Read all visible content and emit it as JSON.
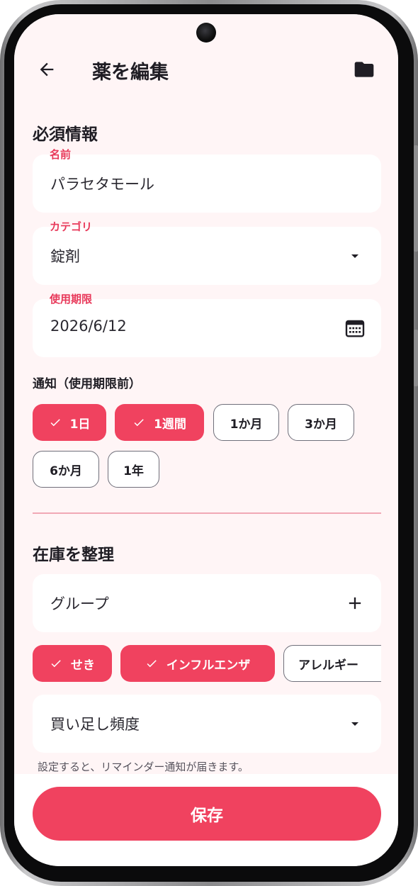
{
  "appbar": {
    "title": "薬を編集",
    "back_icon": "arrow-left-icon",
    "folder_icon": "folder-icon"
  },
  "required": {
    "section_title": "必須情報",
    "name": {
      "label": "名前",
      "value": "パラセタモール"
    },
    "category": {
      "label": "カテゴリ",
      "value": "錠剤",
      "icon": "dropdown-arrow-icon"
    },
    "expiry": {
      "label": "使用期限",
      "value": "2026/6/12",
      "icon": "calendar-icon"
    }
  },
  "notify": {
    "label": "通知（使用期限前）",
    "chips": [
      {
        "label": "1日",
        "selected": true
      },
      {
        "label": "1週間",
        "selected": true
      },
      {
        "label": "1か月",
        "selected": false
      },
      {
        "label": "3か月",
        "selected": false
      },
      {
        "label": "6か月",
        "selected": false
      },
      {
        "label": "1年",
        "selected": false
      }
    ]
  },
  "inventory": {
    "section_title": "在庫を整理",
    "group": {
      "label": "グループ",
      "icon": "plus-icon"
    },
    "group_chips": [
      {
        "label": "せき",
        "selected": true
      },
      {
        "label": "インフルエンザ",
        "selected": true
      },
      {
        "label": "アレルギー",
        "selected": false
      }
    ],
    "refill": {
      "label": "買い足し頻度",
      "icon": "dropdown-arrow-icon"
    },
    "helper_text": "設定すると、リマインダー通知が届きます。"
  },
  "save_label": "保存",
  "colors": {
    "accent": "#f0425f",
    "label_red": "#e8395a",
    "background": "#fff5f6",
    "divider": "#f1a8b5"
  }
}
